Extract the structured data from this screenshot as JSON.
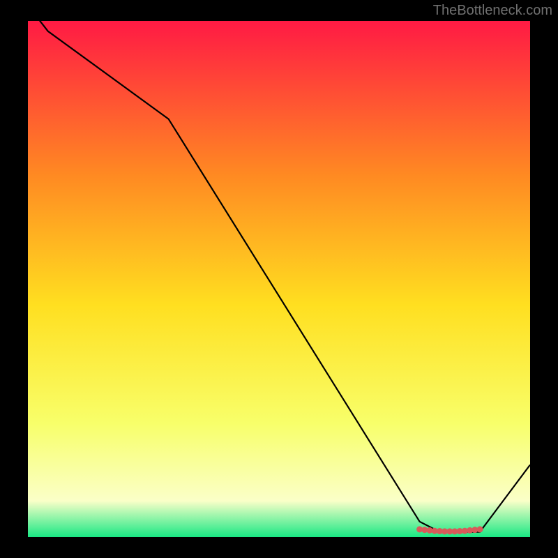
{
  "watermark": "TheBottleneck.com",
  "chart_data": {
    "type": "line",
    "title": "",
    "xlabel": "",
    "ylabel": "",
    "xlim": [
      0,
      100
    ],
    "ylim": [
      0,
      100
    ],
    "grid": false,
    "legend": false,
    "background_gradient": {
      "top_color": "#ff1a44",
      "mid_upper_color": "#ff8a22",
      "mid_color": "#ffdf20",
      "mid_lower_color": "#f8ff6a",
      "lower_band_color": "#faffc8",
      "bottom_color": "#19e884"
    },
    "x": [
      0,
      4,
      28,
      78,
      82,
      90,
      100
    ],
    "values": [
      103,
      98,
      81,
      3,
      1,
      1,
      14
    ],
    "markers": {
      "x": [
        78,
        79,
        80,
        81,
        82,
        83,
        84,
        85,
        86,
        87,
        88,
        89,
        90
      ],
      "y": [
        1.5,
        1.4,
        1.3,
        1.2,
        1.15,
        1.1,
        1.1,
        1.1,
        1.15,
        1.2,
        1.3,
        1.4,
        1.5
      ],
      "color": "#d85a5a",
      "shape": "circle"
    }
  }
}
